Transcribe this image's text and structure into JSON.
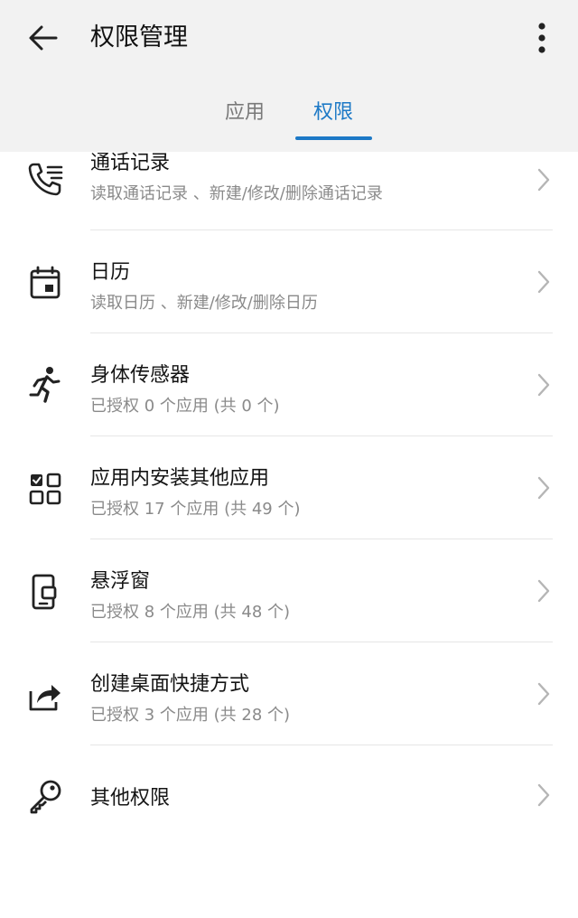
{
  "header": {
    "title": "权限管理"
  },
  "tabs": [
    {
      "label": "应用",
      "selected": false
    },
    {
      "label": "权限",
      "selected": true
    }
  ],
  "accent_color": "#1d79c6",
  "permissions": [
    {
      "icon": "call-log-icon",
      "title": "通话记录",
      "subtitle": "读取通话记录 、新建/修改/删除通话记录"
    },
    {
      "icon": "calendar-icon",
      "title": "日历",
      "subtitle": "读取日历 、新建/修改/删除日历"
    },
    {
      "icon": "running-person-icon",
      "title": "身体传感器",
      "subtitle": "已授权 0 个应用 (共 0 个)"
    },
    {
      "icon": "app-grid-check-icon",
      "title": "应用内安装其他应用",
      "subtitle": "已授权 17 个应用 (共 49 个)"
    },
    {
      "icon": "floating-window-icon",
      "title": "悬浮窗",
      "subtitle": "已授权 8 个应用 (共 48 个)"
    },
    {
      "icon": "share-shortcut-icon",
      "title": "创建桌面快捷方式",
      "subtitle": "已授权 3 个应用 (共 28 个)"
    },
    {
      "icon": "key-icon",
      "title": "其他权限",
      "subtitle": ""
    }
  ]
}
